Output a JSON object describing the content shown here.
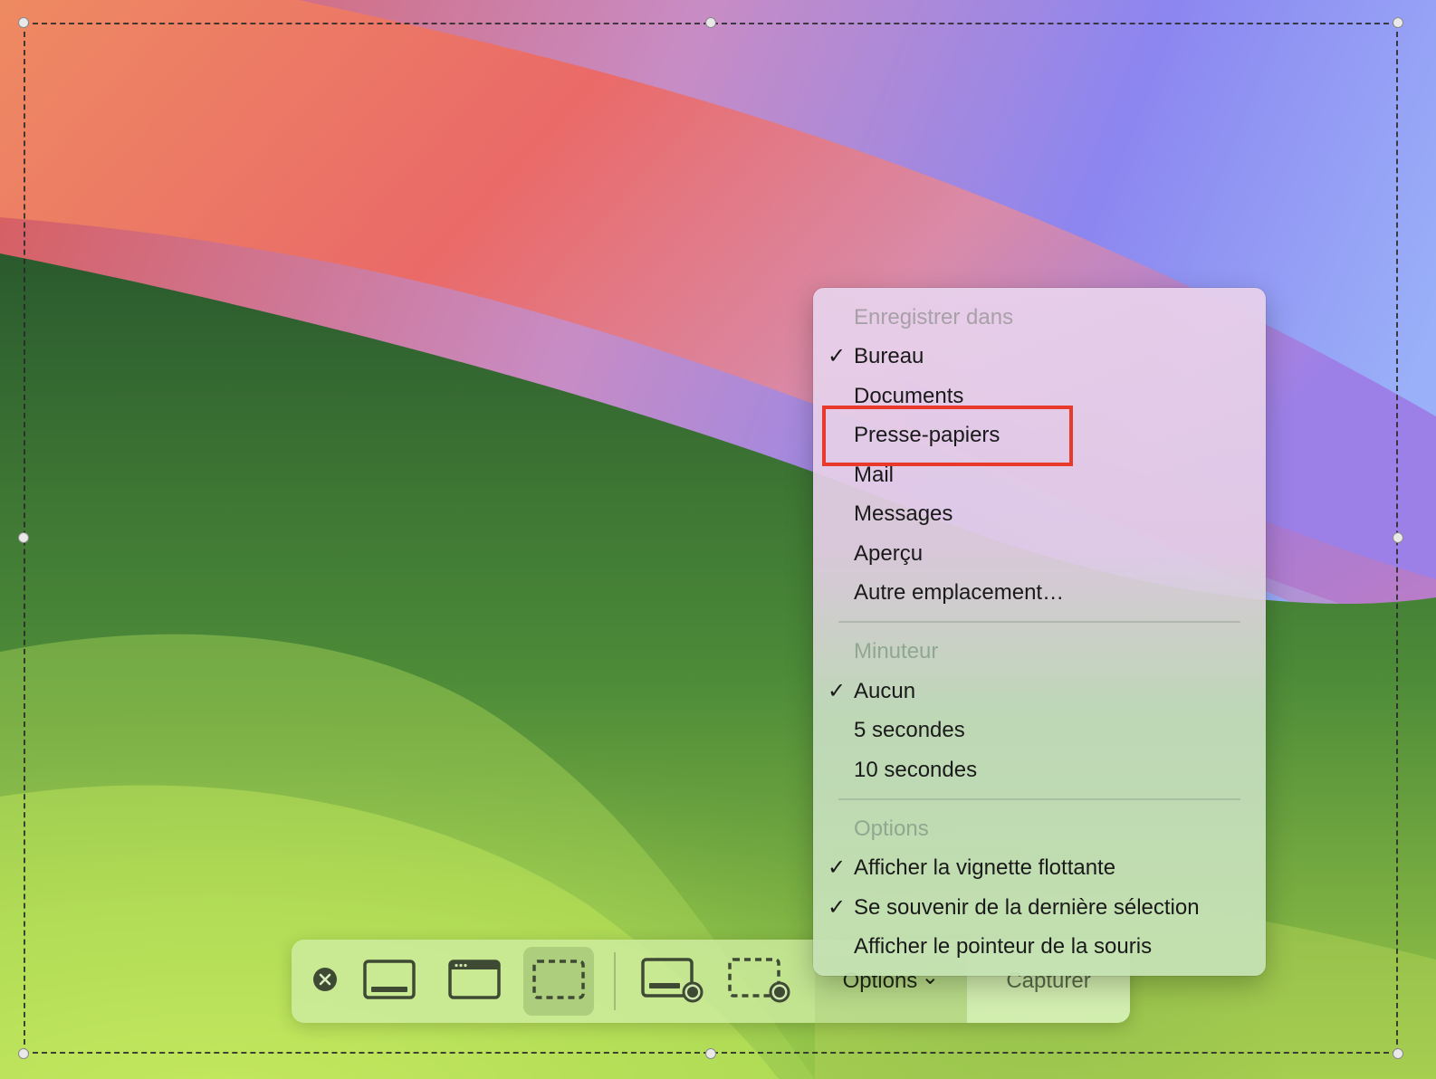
{
  "menu": {
    "save_header": "Enregistrer dans",
    "save_items": [
      {
        "label": "Bureau",
        "checked": true
      },
      {
        "label": "Documents",
        "checked": false
      },
      {
        "label": "Presse-papiers",
        "checked": false,
        "highlighted": true
      },
      {
        "label": "Mail",
        "checked": false
      },
      {
        "label": "Messages",
        "checked": false
      },
      {
        "label": "Aperçu",
        "checked": false
      },
      {
        "label": "Autre emplacement…",
        "checked": false
      }
    ],
    "timer_header": "Minuteur",
    "timer_items": [
      {
        "label": "Aucun",
        "checked": true
      },
      {
        "label": "5 secondes",
        "checked": false
      },
      {
        "label": "10 secondes",
        "checked": false
      }
    ],
    "options_header": "Options",
    "options_items": [
      {
        "label": "Afficher la vignette flottante",
        "checked": true
      },
      {
        "label": "Se souvenir de la dernière sélection",
        "checked": true
      },
      {
        "label": "Afficher le pointeur de la souris",
        "checked": false
      }
    ],
    "check_glyph": "✓"
  },
  "toolbar": {
    "close_icon": "close-circle-icon",
    "tools": [
      {
        "icon": "capture-entire-screen-icon",
        "selected": false
      },
      {
        "icon": "capture-window-icon",
        "selected": false
      },
      {
        "icon": "capture-selection-icon",
        "selected": true
      },
      {
        "icon": "record-entire-screen-icon",
        "selected": false
      },
      {
        "icon": "record-selection-icon",
        "selected": false
      }
    ],
    "options_label": "Options",
    "options_chevron": "⌄",
    "capture_label": "Capturer"
  },
  "colors": {
    "highlight_border": "#e8392a"
  }
}
